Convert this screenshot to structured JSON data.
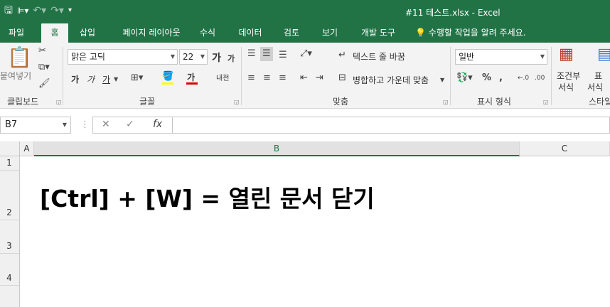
{
  "window": {
    "title": "#11 테스트.xlsx - Excel"
  },
  "tabs": [
    {
      "label": "파일"
    },
    {
      "label": "홈"
    },
    {
      "label": "삽입"
    },
    {
      "label": "페이지 레이아웃"
    },
    {
      "label": "수식"
    },
    {
      "label": "데이터"
    },
    {
      "label": "검토"
    },
    {
      "label": "보기"
    },
    {
      "label": "개발 도구"
    },
    {
      "label": "수행할 작업을 알려 주세요."
    }
  ],
  "ribbon": {
    "clipboard": {
      "paste_label": "붙여넣기",
      "group_label": "클립보드"
    },
    "font": {
      "font_name": "맑은 고딕",
      "font_size": "22",
      "group_label": "글꼴",
      "grow": "가",
      "shrink": "가",
      "bold": "가",
      "italic": "가",
      "underline": "가",
      "color": "가",
      "phonetic": "내천"
    },
    "alignment": {
      "wrap_text": "텍스트 줄 바꿈",
      "merge_center": "병합하고 가운데 맞춤",
      "group_label": "맞춤"
    },
    "number": {
      "format": "일반",
      "group_label": "표시 형식"
    },
    "styles": {
      "conditional_line1": "조건부",
      "conditional_line2": "서식",
      "table_line1": "표",
      "table_line2": "서식",
      "group_label": "스타일"
    }
  },
  "formula_bar": {
    "name_box": "B7",
    "formula": ""
  },
  "sheet": {
    "columns": [
      "A",
      "B",
      "C"
    ],
    "rows": [
      "1",
      "2",
      "3",
      "4"
    ],
    "cell_b2": "[Ctrl] + [W] = 열린 문서 닫기"
  },
  "colors": {
    "accent": "#217346",
    "ribbon": "#f3f3f3"
  }
}
